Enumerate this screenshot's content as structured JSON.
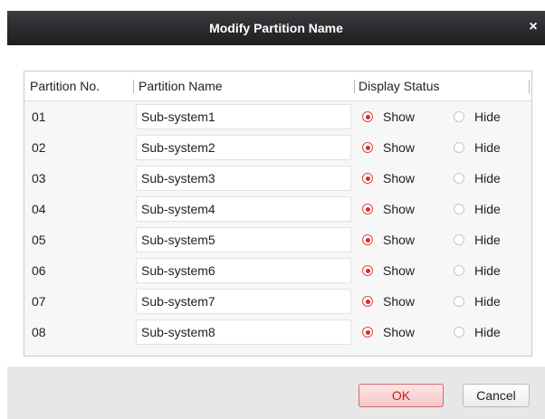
{
  "dialog": {
    "title": "Modify Partition Name",
    "close_glyph": "×",
    "close_icon": "close-icon"
  },
  "table": {
    "headers": {
      "partition_no": "Partition No.",
      "partition_name": "Partition Name",
      "display_status": "Display Status"
    },
    "rows": [
      {
        "no": "01",
        "name": "Sub-system1",
        "status": "Show"
      },
      {
        "no": "02",
        "name": "Sub-system2",
        "status": "Show"
      },
      {
        "no": "03",
        "name": "Sub-system3",
        "status": "Show"
      },
      {
        "no": "04",
        "name": "Sub-system4",
        "status": "Show"
      },
      {
        "no": "05",
        "name": "Sub-system5",
        "status": "Show"
      },
      {
        "no": "06",
        "name": "Sub-system6",
        "status": "Show"
      },
      {
        "no": "07",
        "name": "Sub-system7",
        "status": "Show"
      },
      {
        "no": "08",
        "name": "Sub-system8",
        "status": "Show"
      }
    ],
    "option_show": "Show",
    "option_hide": "Hide"
  },
  "footer": {
    "ok_label": "OK",
    "cancel_label": "Cancel"
  },
  "colors": {
    "titlebar": "#1d1e20",
    "accent_red": "#d62b2b",
    "ok_border": "#d56a6a"
  }
}
